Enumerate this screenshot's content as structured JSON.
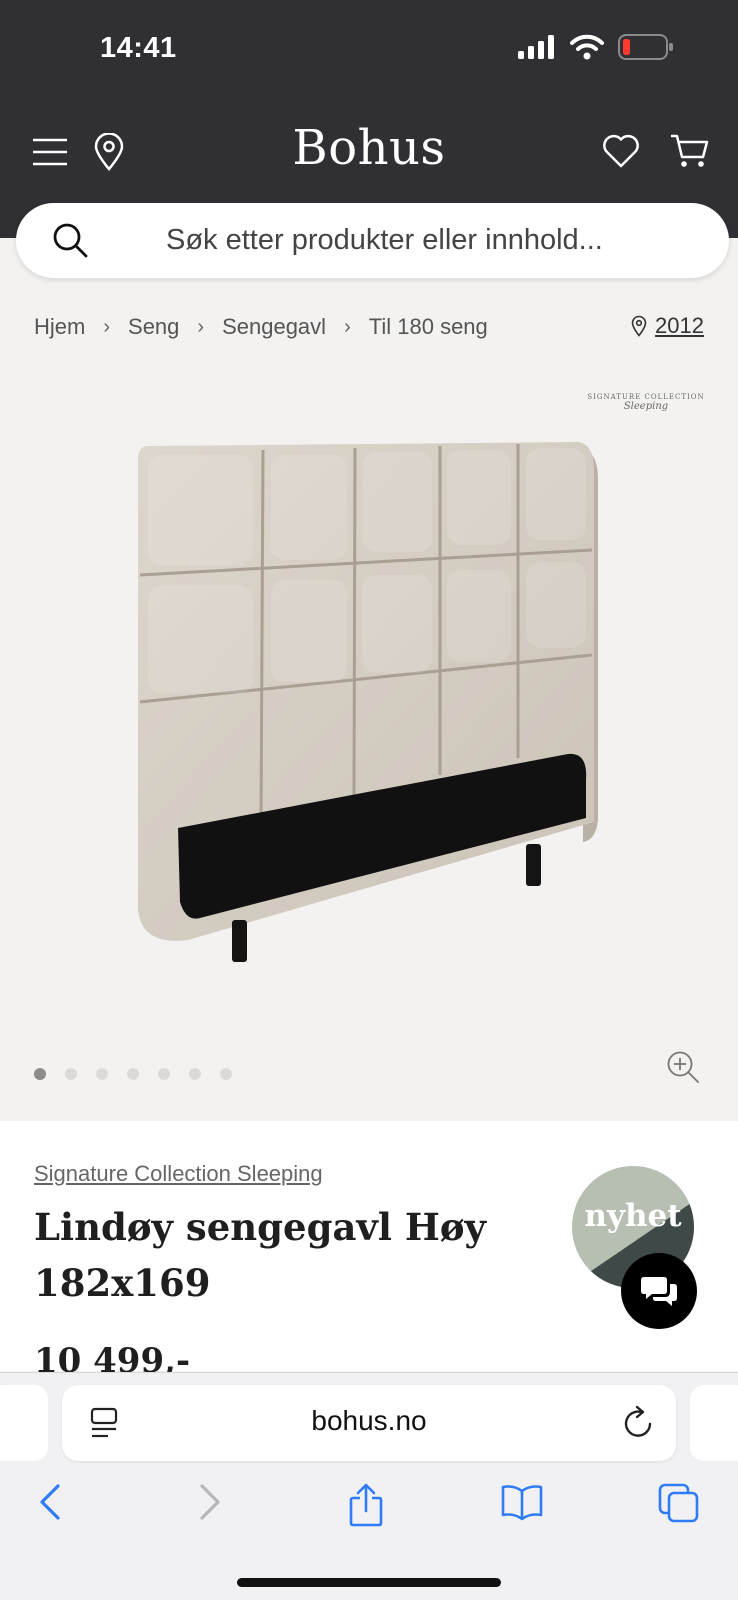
{
  "status_bar": {
    "time": "14:41"
  },
  "header": {
    "logo": "Bohus"
  },
  "search": {
    "placeholder": "Søk etter produkter eller innhold..."
  },
  "breadcrumb": {
    "items": [
      "Hjem",
      "Seng",
      "Sengegavl",
      "Til 180 seng"
    ],
    "store_number": "2012"
  },
  "gallery": {
    "brand_mark_top": "SIGNATURE COLLECTION",
    "brand_mark_script": "Sleeping",
    "image_count": 7,
    "active_index": 0
  },
  "product": {
    "brand": "Signature Collection Sleeping",
    "title": "Lindøy sengegavl Høy 182x169",
    "price": "10 499,-",
    "badge": "nyhet"
  },
  "safari": {
    "url": "bohus.no"
  },
  "colors": {
    "header_bg": "#2f2f34",
    "badge_light": "#b6bfb1",
    "badge_dark": "#3f4a48",
    "ios_blue": "#2f7cf6",
    "fabric": "#d6cfc5"
  }
}
